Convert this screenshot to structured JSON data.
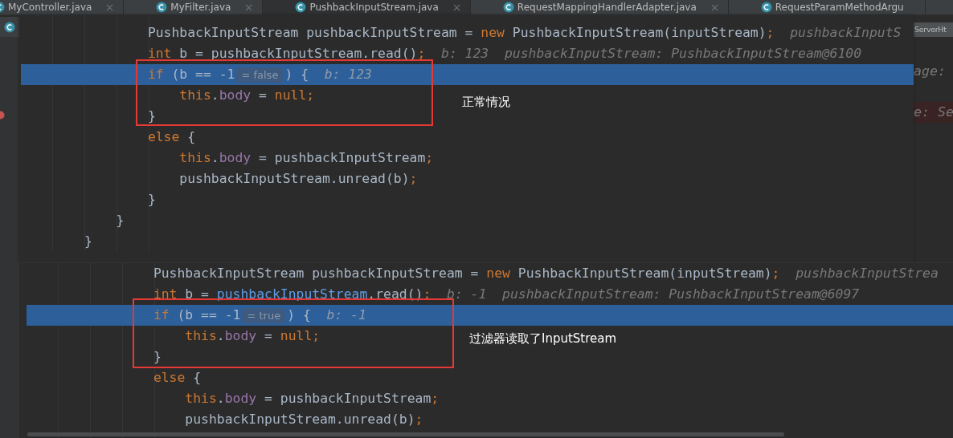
{
  "tabs": [
    {
      "label": "MyController.java",
      "selected": false,
      "close_button": true
    },
    {
      "label": "MyFilter.java",
      "selected": false,
      "close_button": true
    },
    {
      "label": "PushbackInputStream.java",
      "selected": true,
      "close_button": true
    },
    {
      "label": "RequestMappingHandlerAdapter.java",
      "selected": false,
      "close_button": true
    },
    {
      "label": "RequestParamMethodArgu",
      "selected": false,
      "close_button": false
    }
  ],
  "background_editor": {
    "second_tab": "ServerHt",
    "hints": [
      {
        "text": "age:",
        "breakpoint": false
      },
      {
        "text": "e: Se",
        "breakpoint": true
      }
    ]
  },
  "panels": [
    {
      "annotation": "正常情况",
      "lines": [
        {
          "children": [
            {
              "children": [
                {
                  "current": false,
                  "segments": [
                    {
                      "kind": "code",
                      "tokens": [
                        {
                          "kind": "plain",
                          "text": "PushbackInputStream pushbackInputStream = "
                        },
                        {
                          "kind": "keyword",
                          "text": "new"
                        },
                        {
                          "kind": "plain",
                          "text": " PushbackInputStream(inputStream)"
                        },
                        {
                          "kind": "keyword",
                          "text": ";"
                        }
                      ]
                    },
                    {
                      "kind": "hint",
                      "text": "pushbackInputS"
                    }
                  ]
                },
                {
                  "current": false,
                  "segments": [
                    {
                      "kind": "code",
                      "tokens": [
                        {
                          "kind": "keyword",
                          "text": "int"
                        },
                        {
                          "kind": "plain",
                          "text": " b = pushbackInputStream.read()"
                        },
                        {
                          "kind": "keyword",
                          "text": ";"
                        }
                      ]
                    },
                    {
                      "kind": "hint",
                      "text": "b: 123  pushbackInputStream: PushbackInputStream@6100"
                    }
                  ]
                },
                {
                  "current": true,
                  "segments": [
                    {
                      "kind": "code",
                      "tokens": [
                        {
                          "kind": "keyword",
                          "text": "if"
                        },
                        {
                          "kind": "plain",
                          "text": " (b == -1"
                        }
                      ]
                    },
                    {
                      "kind": "badge",
                      "text": "= false"
                    },
                    {
                      "kind": "code",
                      "tokens": [
                        {
                          "kind": "plain",
                          "text": ") {"
                        }
                      ]
                    },
                    {
                      "kind": "hint",
                      "text": "b: 123"
                    }
                  ],
                  "children": [
                    {
                      "current": false,
                      "segments": [
                        {
                          "kind": "code",
                          "tokens": [
                            {
                              "kind": "keyword",
                              "text": "this"
                            },
                            {
                              "kind": "plain",
                              "text": "."
                            },
                            {
                              "kind": "field",
                              "text": "body"
                            },
                            {
                              "kind": "plain",
                              "text": " = "
                            },
                            {
                              "kind": "keyword",
                              "text": "null;"
                            }
                          ]
                        }
                      ]
                    }
                  ]
                },
                {
                  "current": false,
                  "segments": [
                    {
                      "kind": "code",
                      "tokens": [
                        {
                          "kind": "plain",
                          "text": "}"
                        }
                      ]
                    }
                  ]
                },
                {
                  "current": false,
                  "segments": [
                    {
                      "kind": "code",
                      "tokens": [
                        {
                          "kind": "keyword",
                          "text": "else"
                        },
                        {
                          "kind": "plain",
                          "text": " {"
                        }
                      ]
                    }
                  ],
                  "children": [
                    {
                      "current": false,
                      "segments": [
                        {
                          "kind": "code",
                          "tokens": [
                            {
                              "kind": "keyword",
                              "text": "this"
                            },
                            {
                              "kind": "plain",
                              "text": "."
                            },
                            {
                              "kind": "field",
                              "text": "body"
                            },
                            {
                              "kind": "plain",
                              "text": " = pushbackInputStream"
                            },
                            {
                              "kind": "keyword",
                              "text": ";"
                            }
                          ]
                        }
                      ]
                    },
                    {
                      "current": false,
                      "segments": [
                        {
                          "kind": "code",
                          "tokens": [
                            {
                              "kind": "plain",
                              "text": "pushbackInputStream.unread(b)"
                            },
                            {
                              "kind": "keyword",
                              "text": ";"
                            }
                          ]
                        }
                      ]
                    }
                  ]
                },
                {
                  "current": false,
                  "segments": [
                    {
                      "kind": "code",
                      "tokens": [
                        {
                          "kind": "plain",
                          "text": "}"
                        }
                      ]
                    }
                  ]
                }
              ]
            },
            {
              "current": false,
              "segments": [
                {
                  "kind": "code",
                  "tokens": [
                    {
                      "kind": "plain",
                      "text": "}"
                    }
                  ]
                }
              ]
            }
          ]
        },
        {
          "current": false,
          "segments": [
            {
              "kind": "code",
              "tokens": [
                {
                  "kind": "plain",
                  "text": "}"
                }
              ]
            }
          ]
        }
      ]
    },
    {
      "annotation": "过滤器读取了InputStream",
      "lines": [
        {
          "children": [
            {
              "children": [
                {
                  "current": false,
                  "segments": [
                    {
                      "kind": "code",
                      "tokens": [
                        {
                          "kind": "plain",
                          "text": "PushbackInputStream pushbackInputStream = "
                        },
                        {
                          "kind": "keyword",
                          "text": "new"
                        },
                        {
                          "kind": "plain",
                          "text": " PushbackInputStream(inputStream)"
                        },
                        {
                          "kind": "keyword",
                          "text": ";"
                        }
                      ]
                    },
                    {
                      "kind": "hint",
                      "text": "pushbackInputStrea"
                    }
                  ]
                },
                {
                  "current": false,
                  "segments": [
                    {
                      "kind": "code",
                      "tokens": [
                        {
                          "kind": "keyword",
                          "text": "int"
                        },
                        {
                          "kind": "plain",
                          "text": " b = "
                        },
                        {
                          "kind": "reference",
                          "text": "pushbackInputStream"
                        },
                        {
                          "kind": "plain",
                          "text": ".read()"
                        },
                        {
                          "kind": "keyword",
                          "text": ";"
                        }
                      ]
                    },
                    {
                      "kind": "hint",
                      "text": "b: -1  pushbackInputStream: PushbackInputStream@6097"
                    }
                  ]
                },
                {
                  "current": true,
                  "segments": [
                    {
                      "kind": "code",
                      "tokens": [
                        {
                          "kind": "keyword",
                          "text": "if"
                        },
                        {
                          "kind": "plain",
                          "text": " (b == -1"
                        }
                      ]
                    },
                    {
                      "kind": "badge",
                      "text": "= true"
                    },
                    {
                      "kind": "code",
                      "tokens": [
                        {
                          "kind": "plain",
                          "text": ") {"
                        }
                      ]
                    },
                    {
                      "kind": "hint",
                      "text": "b: -1"
                    }
                  ],
                  "children": [
                    {
                      "current": false,
                      "segments": [
                        {
                          "kind": "code",
                          "tokens": [
                            {
                              "kind": "keyword",
                              "text": "this"
                            },
                            {
                              "kind": "plain",
                              "text": "."
                            },
                            {
                              "kind": "field",
                              "text": "body"
                            },
                            {
                              "kind": "plain",
                              "text": " = "
                            },
                            {
                              "kind": "keyword",
                              "text": "null;"
                            }
                          ]
                        }
                      ]
                    }
                  ]
                },
                {
                  "current": false,
                  "segments": [
                    {
                      "kind": "code",
                      "tokens": [
                        {
                          "kind": "plain",
                          "text": "}"
                        }
                      ]
                    }
                  ]
                },
                {
                  "current": false,
                  "segments": [
                    {
                      "kind": "code",
                      "tokens": [
                        {
                          "kind": "keyword",
                          "text": "else"
                        },
                        {
                          "kind": "plain",
                          "text": " {"
                        }
                      ]
                    }
                  ],
                  "children": [
                    {
                      "current": false,
                      "segments": [
                        {
                          "kind": "code",
                          "tokens": [
                            {
                              "kind": "keyword",
                              "text": "this"
                            },
                            {
                              "kind": "plain",
                              "text": "."
                            },
                            {
                              "kind": "field",
                              "text": "body"
                            },
                            {
                              "kind": "plain",
                              "text": " = pushbackInputStream"
                            },
                            {
                              "kind": "keyword",
                              "text": ";"
                            }
                          ]
                        }
                      ]
                    },
                    {
                      "current": false,
                      "segments": [
                        {
                          "kind": "code",
                          "tokens": [
                            {
                              "kind": "plain",
                              "text": "pushbackInputStream.unread(b)"
                            },
                            {
                              "kind": "keyword",
                              "text": ";"
                            }
                          ]
                        }
                      ]
                    }
                  ]
                }
              ]
            }
          ]
        }
      ]
    }
  ]
}
